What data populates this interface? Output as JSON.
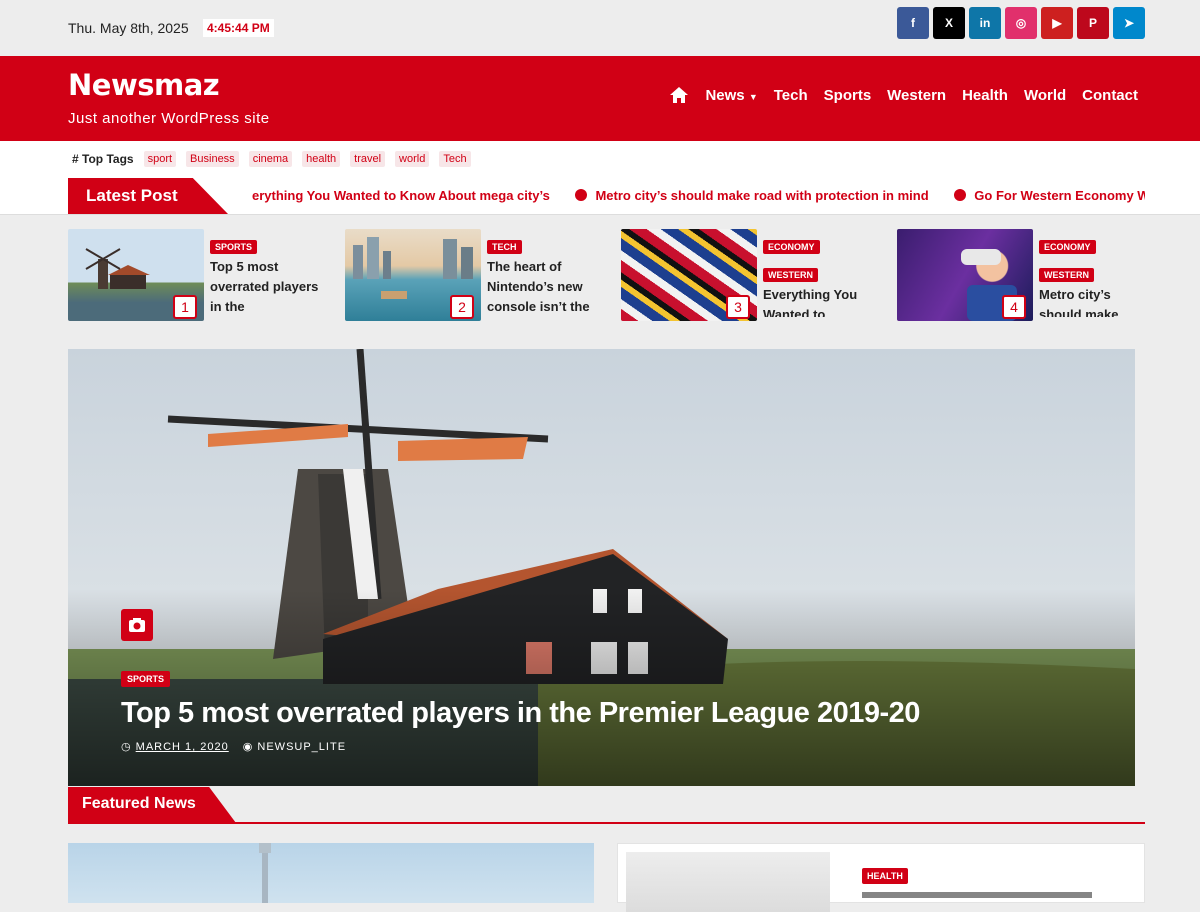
{
  "topbar": {
    "date": "Thu. May 8th, 2025",
    "time": "4:45:44 PM",
    "social": [
      {
        "icon": "facebook-icon",
        "glyph": "f",
        "color": "#3b5998"
      },
      {
        "icon": "x-icon",
        "glyph": "X",
        "color": "#000000"
      },
      {
        "icon": "linkedin-icon",
        "glyph": "in",
        "color": "#0e76a8"
      },
      {
        "icon": "instagram-icon",
        "glyph": "◎",
        "color": "#e1306c"
      },
      {
        "icon": "youtube-icon",
        "glyph": "▶",
        "color": "#cd201f"
      },
      {
        "icon": "pinterest-icon",
        "glyph": "P",
        "color": "#bd081c"
      },
      {
        "icon": "telegram-icon",
        "glyph": "➤",
        "color": "#0088cc"
      }
    ]
  },
  "header": {
    "brand": "Newsmaz",
    "tagline": "Just another WordPress site",
    "accent": "#d10015",
    "nav": [
      "News",
      "Tech",
      "Sports",
      "Western",
      "Health",
      "World",
      "Contact"
    ]
  },
  "tags": {
    "title": "Top Tags",
    "items": [
      "sport",
      "Business",
      "cinema",
      "health",
      "travel",
      "world",
      "Tech"
    ]
  },
  "latest": {
    "label": "Latest Post",
    "items": [
      "erything You Wanted to Know About mega city’s",
      "Metro city’s should make road with protection in mind",
      "Go For Western Economy With"
    ]
  },
  "cards": [
    {
      "num": "1",
      "cats": [
        "SPORTS"
      ],
      "title": "Top 5 most overrated players in the"
    },
    {
      "num": "2",
      "cats": [
        "TECH"
      ],
      "title": "The heart of Nintendo’s new console isn’t the"
    },
    {
      "num": "3",
      "cats": [
        "ECONOMY",
        "WESTERN"
      ],
      "title": "Everything You Wanted to"
    },
    {
      "num": "4",
      "cats": [
        "ECONOMY",
        "WESTERN"
      ],
      "title": "Metro city’s should make"
    }
  ],
  "hero": {
    "category": "SPORTS",
    "title": "Top 5 most overrated players in the Premier League 2019-20",
    "date": "MARCH 1, 2020",
    "author": "NEWSUP_LITE"
  },
  "featured": {
    "label": "Featured News",
    "card_category": "HEALTH"
  }
}
